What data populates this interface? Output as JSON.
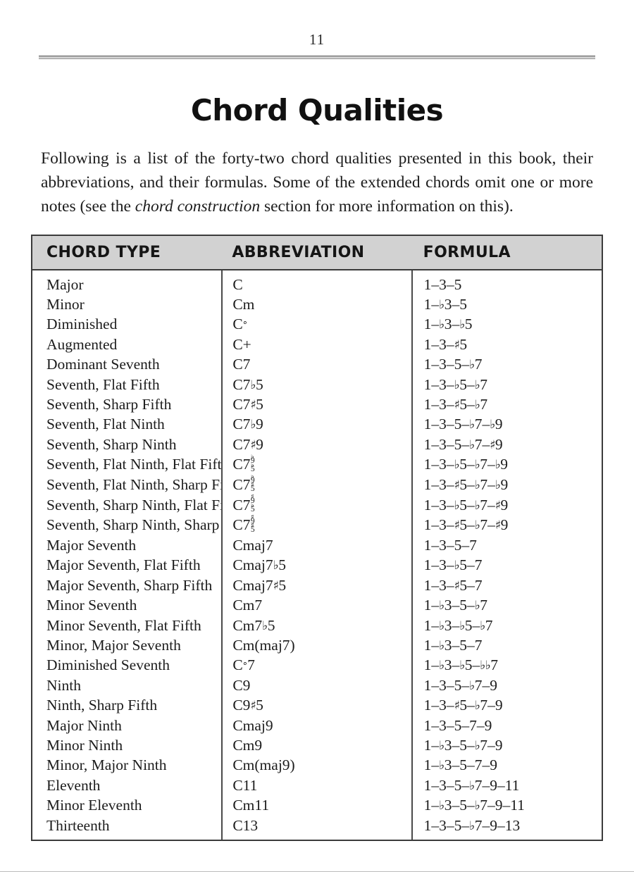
{
  "page": {
    "number": "11",
    "title": "Chord Qualities"
  },
  "intro": {
    "part1": "Following is a list of the forty-two chord qualities presented in this book, their abbreviations, and their formulas. Some of the extended chords omit one or more notes (see the ",
    "italic": "chord construction",
    "part2": " section for more information on this)."
  },
  "table": {
    "headers": {
      "chord_type": "CHORD TYPE",
      "abbreviation": "ABBREVIATION",
      "formula": "FORMULA"
    },
    "rows": [
      {
        "type": "Major",
        "abbr": "C",
        "abbr_html": "C",
        "formula": "1–3–5",
        "formula_html": "1–3–5"
      },
      {
        "type": "Minor",
        "abbr": "Cm",
        "abbr_html": "Cm",
        "formula": "1–♭3–5",
        "formula_html": "1–<span class=\"acc\">♭</span>3–5"
      },
      {
        "type": "Diminished",
        "abbr": "C°",
        "abbr_html": "C<span class=\"acc-sm\">°</span>",
        "formula": "1–♭3–♭5",
        "formula_html": "1–<span class=\"acc\">♭</span>3–<span class=\"acc\">♭</span>5"
      },
      {
        "type": "Augmented",
        "abbr": "C+",
        "abbr_html": "C+",
        "formula": "1–3–♯5",
        "formula_html": "1–3–<span class=\"acc\">♯</span>5"
      },
      {
        "type": "Dominant Seventh",
        "abbr": "C7",
        "abbr_html": "C7",
        "formula": "1–3–5–♭7",
        "formula_html": "1–3–5–<span class=\"acc\">♭</span>7"
      },
      {
        "type": "Seventh, Flat Fifth",
        "abbr": "C7♭5",
        "abbr_html": "C7<span class=\"acc\">♭</span>5",
        "formula": "1–3–♭5–♭7",
        "formula_html": "1–3–<span class=\"acc\">♭</span>5–<span class=\"acc\">♭</span>7"
      },
      {
        "type": "Seventh, Sharp Fifth",
        "abbr": "C7♯5",
        "abbr_html": "C7<span class=\"acc\">♯</span>5",
        "formula": "1–3–♯5–♭7",
        "formula_html": "1–3–<span class=\"acc\">♯</span>5–<span class=\"acc\">♭</span>7"
      },
      {
        "type": "Seventh, Flat Ninth",
        "abbr": "C7♭9",
        "abbr_html": "C7<span class=\"acc\">♭</span>9",
        "formula": "1–3–5–♭7–♭9",
        "formula_html": "1–3–5–<span class=\"acc\">♭</span>7–<span class=\"acc\">♭</span>9"
      },
      {
        "type": "Seventh, Sharp Ninth",
        "abbr": "C7♯9",
        "abbr_html": "C7<span class=\"acc\">♯</span>9",
        "formula": "1–3–5–♭7–♯9",
        "formula_html": "1–3–5–<span class=\"acc\">♭</span>7–<span class=\"acc\">♯</span>9"
      },
      {
        "type": "Seventh, Flat Ninth, Flat Fifth",
        "abbr": "C7♭9/♭5",
        "abbr_html": "C7<span class=\"stack\"><span><span class=\"acc-sm\">♭</span>9</span><span><span class=\"acc-sm\">♭</span>5</span></span>",
        "formula": "1–3–♭5–♭7–♭9",
        "formula_html": "1–3–<span class=\"acc\">♭</span>5–<span class=\"acc\">♭</span>7–<span class=\"acc\">♭</span>9"
      },
      {
        "type": "Seventh, Flat Ninth, Sharp Fifth",
        "abbr": "C7♭9/♯5",
        "abbr_html": "C7<span class=\"stack\"><span><span class=\"acc-sm\">♭</span>9</span><span><span class=\"acc-sm\">♯</span>5</span></span>",
        "formula": "1–3–♯5–♭7–♭9",
        "formula_html": "1–3–<span class=\"acc\">♯</span>5–<span class=\"acc\">♭</span>7–<span class=\"acc\">♭</span>9"
      },
      {
        "type": "Seventh, Sharp Ninth, Flat Fifth",
        "abbr": "C7♯9/♭5",
        "abbr_html": "C7<span class=\"stack\"><span><span class=\"acc-sm\">♯</span>9</span><span><span class=\"acc-sm\">♭</span>5</span></span>",
        "formula": "1–3–♭5–♭7–♯9",
        "formula_html": "1–3–<span class=\"acc\">♭</span>5–<span class=\"acc\">♭</span>7–<span class=\"acc\">♯</span>9"
      },
      {
        "type": "Seventh, Sharp Ninth, Sharp Fifth",
        "abbr": "C7♯9/♯5",
        "abbr_html": "C7<span class=\"stack\"><span><span class=\"acc-sm\">♯</span>9</span><span><span class=\"acc-sm\">♯</span>5</span></span>",
        "formula": "1–3–♯5–♭7–♯9",
        "formula_html": "1–3–<span class=\"acc\">♯</span>5–<span class=\"acc\">♭</span>7–<span class=\"acc\">♯</span>9"
      },
      {
        "type": "Major Seventh",
        "abbr": "Cmaj7",
        "abbr_html": "Cmaj7",
        "formula": "1–3–5–7",
        "formula_html": "1–3–5–7"
      },
      {
        "type": "Major Seventh, Flat Fifth",
        "abbr": "Cmaj7♭5",
        "abbr_html": "Cmaj7<span class=\"acc\">♭</span>5",
        "formula": "1–3–♭5–7",
        "formula_html": "1–3–<span class=\"acc\">♭</span>5–7"
      },
      {
        "type": "Major Seventh, Sharp Fifth",
        "abbr": "Cmaj7♯5",
        "abbr_html": "Cmaj7<span class=\"acc\">♯</span>5",
        "formula": "1–3–♯5–7",
        "formula_html": "1–3–<span class=\"acc\">♯</span>5–7"
      },
      {
        "type": "Minor Seventh",
        "abbr": "Cm7",
        "abbr_html": "Cm7",
        "formula": "1–♭3–5–♭7",
        "formula_html": "1–<span class=\"acc\">♭</span>3–5–<span class=\"acc\">♭</span>7"
      },
      {
        "type": "Minor Seventh, Flat Fifth",
        "abbr": "Cm7♭5",
        "abbr_html": "Cm7<span class=\"acc\">♭</span>5",
        "formula": "1–♭3–♭5–♭7",
        "formula_html": "1–<span class=\"acc\">♭</span>3–<span class=\"acc\">♭</span>5–<span class=\"acc\">♭</span>7"
      },
      {
        "type": "Minor, Major Seventh",
        "abbr": "Cm(maj7)",
        "abbr_html": "Cm(maj7)",
        "formula": "1–♭3–5–7",
        "formula_html": "1–<span class=\"acc\">♭</span>3–5–7"
      },
      {
        "type": "Diminished Seventh",
        "abbr": "C°7",
        "abbr_html": "C<span class=\"acc-sm\">°</span>7",
        "formula": "1–♭3–♭5–𝄫7",
        "formula_html": "1–<span class=\"acc\">♭</span>3–<span class=\"acc\">♭</span>5–<span class=\"acc\">♭♭</span>7"
      },
      {
        "type": "Ninth",
        "abbr": "C9",
        "abbr_html": "C9",
        "formula": "1–3–5–♭7–9",
        "formula_html": "1–3–5–<span class=\"acc\">♭</span>7–9"
      },
      {
        "type": "Ninth, Sharp Fifth",
        "abbr": "C9♯5",
        "abbr_html": "C9<span class=\"acc\">♯</span>5",
        "formula": "1–3–♯5–♭7–9",
        "formula_html": "1–3–<span class=\"acc\">♯</span>5–<span class=\"acc\">♭</span>7–9"
      },
      {
        "type": "Major Ninth",
        "abbr": "Cmaj9",
        "abbr_html": "Cmaj9",
        "formula": "1–3–5–7–9",
        "formula_html": "1–3–5–7–9"
      },
      {
        "type": "Minor Ninth",
        "abbr": "Cm9",
        "abbr_html": "Cm9",
        "formula": "1–♭3–5–♭7–9",
        "formula_html": "1–<span class=\"acc\">♭</span>3–5–<span class=\"acc\">♭</span>7–9"
      },
      {
        "type": "Minor, Major Ninth",
        "abbr": "Cm(maj9)",
        "abbr_html": "Cm(maj9)",
        "formula": "1–♭3–5–7–9",
        "formula_html": "1–<span class=\"acc\">♭</span>3–5–7–9"
      },
      {
        "type": "Eleventh",
        "abbr": "C11",
        "abbr_html": "C11",
        "formula": "1–3–5–♭7–9–11",
        "formula_html": "1–3–5–<span class=\"acc\">♭</span>7–9–11"
      },
      {
        "type": "Minor Eleventh",
        "abbr": "Cm11",
        "abbr_html": "Cm11",
        "formula": "1–♭3–5–♭7–9–11",
        "formula_html": "1–<span class=\"acc\">♭</span>3–5–<span class=\"acc\">♭</span>7–9–11"
      },
      {
        "type": "Thirteenth",
        "abbr": "C13",
        "abbr_html": "C13",
        "formula": "1–3–5–♭7–9–13",
        "formula_html": "1–3–5–<span class=\"acc\">♭</span>7–9–13"
      }
    ]
  }
}
